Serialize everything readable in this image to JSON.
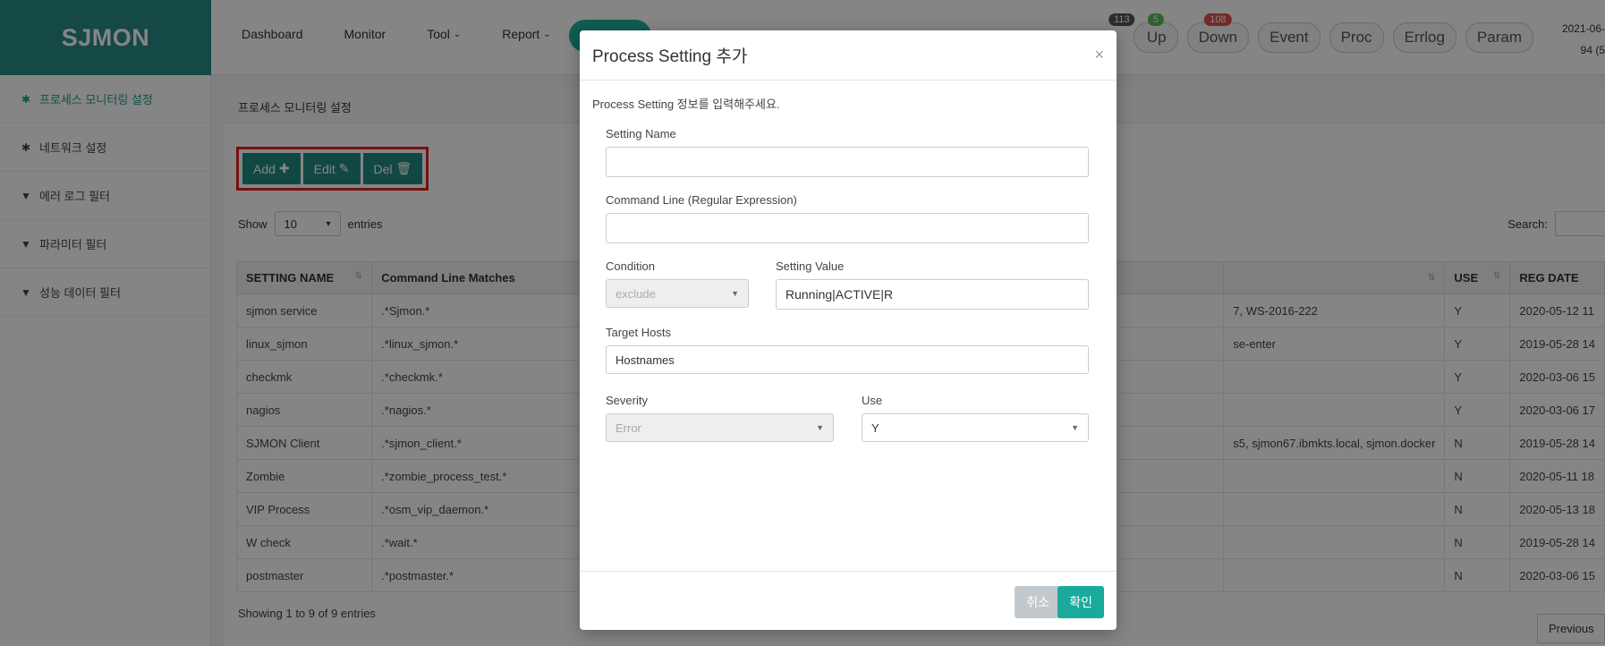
{
  "app": {
    "logo": "SJMON"
  },
  "topnav": [
    {
      "label": "Dashboard",
      "has_menu": false
    },
    {
      "label": "Monitor",
      "has_menu": false
    },
    {
      "label": "Tool",
      "has_menu": true
    },
    {
      "label": "Report",
      "has_menu": true
    }
  ],
  "status_tabs": [
    {
      "label": "Up",
      "count": "5",
      "color": "#5cb85c"
    },
    {
      "label": "Down",
      "count": "108",
      "color": "#d9534f"
    },
    {
      "label": "Event"
    },
    {
      "label": "Proc"
    },
    {
      "label": "Errlog"
    },
    {
      "label": "Param"
    }
  ],
  "status_total_badge": "113",
  "datetime": {
    "line1": "2021-06-",
    "line2": "94 (5"
  },
  "sidebar": {
    "items": [
      {
        "label": "프로세스 모니터링 설정",
        "icon": "gear-icon",
        "active": true
      },
      {
        "label": "네트워크 설정",
        "icon": "gear-icon",
        "active": false
      },
      {
        "label": "에러 로그 필터",
        "icon": "filter-icon",
        "active": false
      },
      {
        "label": "파라미터 필터",
        "icon": "filter-icon",
        "active": false
      },
      {
        "label": "성능 데이터 필터",
        "icon": "filter-icon",
        "active": false
      }
    ]
  },
  "page": {
    "breadcrumb": "프로세스 모니터링 설정",
    "buttons": {
      "add": "Add",
      "edit": "Edit",
      "del": "Del"
    },
    "show_label": "Show",
    "entries_value": "10",
    "entries_label": "entries",
    "search_label": "Search:",
    "showing": "Showing 1 to 9 of 9 entries",
    "previous": "Previous"
  },
  "table": {
    "headers": [
      "SETTING NAME",
      "Command Line Matches",
      "",
      "USE",
      "REG DATE"
    ],
    "rows": [
      [
        "sjmon service",
        ".*Sjmon.*",
        "7, WS-2016-222",
        "Y",
        "2020-05-12 11"
      ],
      [
        "linux_sjmon",
        ".*linux_sjmon.*",
        "se-enter",
        "Y",
        "2019-05-28 14"
      ],
      [
        "checkmk",
        ".*checkmk.*",
        "",
        "Y",
        "2020-03-06 15"
      ],
      [
        "nagios",
        ".*nagios.*",
        "",
        "Y",
        "2020-03-06 17"
      ],
      [
        "SJMON Client",
        ".*sjmon_client.*",
        "s5, sjmon67.ibmkts.local, sjmon.docker",
        "N",
        "2019-05-28 14"
      ],
      [
        "Zombie",
        ".*zombie_process_test.*",
        "",
        "N",
        "2020-05-11 18"
      ],
      [
        "VIP Process",
        ".*osm_vip_daemon.*",
        "",
        "N",
        "2020-05-13 18"
      ],
      [
        "W check",
        ".*wait.*",
        "",
        "N",
        "2019-05-28 14"
      ],
      [
        "postmaster",
        ".*postmaster.*",
        "",
        "N",
        "2020-03-06 15"
      ]
    ]
  },
  "modal": {
    "title": "Process Setting 추가",
    "close": "×",
    "description": "Process Setting 정보를 입력해주세요.",
    "setting_name": {
      "label": "Setting Name",
      "value": ""
    },
    "command_line": {
      "label": "Command Line (Regular Expression)",
      "value": ""
    },
    "condition": {
      "label": "Condition",
      "value": "exclude"
    },
    "setting_value": {
      "label": "Setting Value",
      "value": "Running|ACTIVE|R"
    },
    "target_hosts": {
      "label": "Target Hosts",
      "value": "Hostnames"
    },
    "severity": {
      "label": "Severity",
      "value": "Error"
    },
    "use": {
      "label": "Use",
      "value": "Y"
    },
    "cancel": "취소",
    "confirm": "확인"
  }
}
